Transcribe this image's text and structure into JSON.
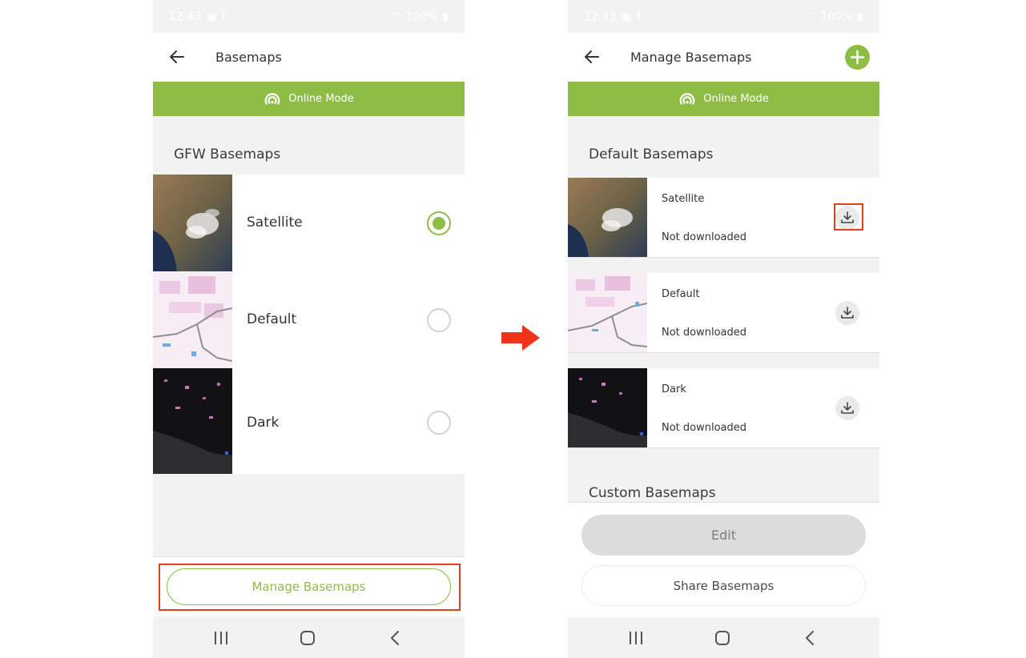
{
  "status_bar": {
    "time": "12:43",
    "battery": "100%"
  },
  "left_screen": {
    "title": "Basemaps",
    "banner_label": "Online Mode",
    "section_title": "GFW Basemaps",
    "items": [
      {
        "label": "Satellite",
        "selected": true
      },
      {
        "label": "Default",
        "selected": false
      },
      {
        "label": "Dark",
        "selected": false
      }
    ],
    "manage_button": "Manage Basemaps"
  },
  "right_screen": {
    "title": "Manage Basemaps",
    "banner_label": "Online Mode",
    "default_section_title": "Default Basemaps",
    "items": [
      {
        "name": "Satellite",
        "status": "Not downloaded"
      },
      {
        "name": "Default",
        "status": "Not downloaded"
      },
      {
        "name": "Dark",
        "status": "Not downloaded"
      }
    ],
    "custom_section_title": "Custom Basemaps",
    "edit_button": "Edit",
    "share_button": "Share Basemaps"
  },
  "icons": {
    "back": "back-arrow-icon",
    "add": "plus-circle-icon",
    "online": "signal-broadcast-icon",
    "download": "download-icon",
    "nav_recents": "recents-icon",
    "nav_home": "home-icon",
    "nav_back": "chevron-left-icon",
    "flow": "right-arrow-icon"
  },
  "colors": {
    "accent_green": "#8fbc44",
    "highlight_red": "#e2401c",
    "background": "#f2f2f2"
  }
}
